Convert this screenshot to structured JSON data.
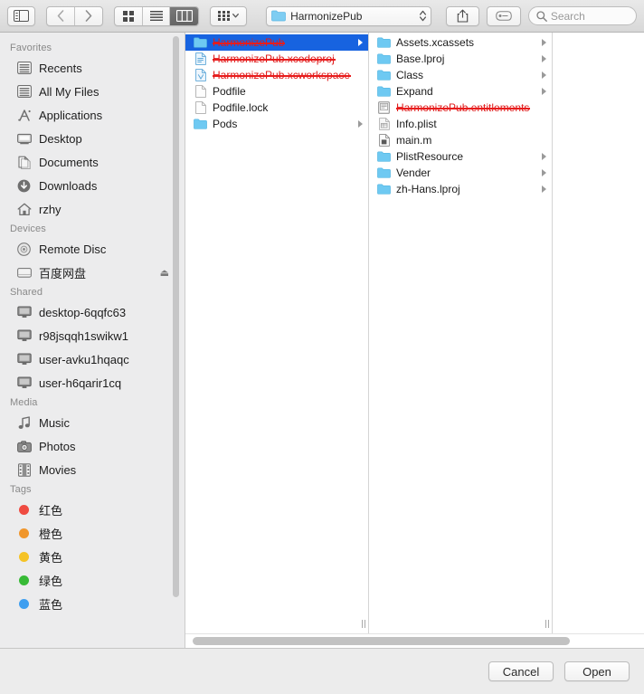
{
  "window": {
    "title": "HarmonizePub"
  },
  "toolbar": {
    "sidebar_toggle": "sidebar-toggle",
    "back_label": "Back",
    "forward_label": "Forward",
    "view_icon_label": "Icon View",
    "view_list_label": "List View",
    "view_column_label": "Column View",
    "arrange_label": "Arrange By",
    "path_label": "HarmonizePub",
    "share_label": "Share",
    "tag_label": "Tags",
    "search_placeholder": "Search"
  },
  "sidebar": {
    "sections": [
      {
        "title": "Favorites",
        "items": [
          {
            "label": "Recents",
            "icon": "recents-icon"
          },
          {
            "label": "All My Files",
            "icon": "all-my-files-icon"
          },
          {
            "label": "Applications",
            "icon": "applications-icon"
          },
          {
            "label": "Desktop",
            "icon": "desktop-icon"
          },
          {
            "label": "Documents",
            "icon": "documents-icon"
          },
          {
            "label": "Downloads",
            "icon": "downloads-icon"
          },
          {
            "label": "rzhy",
            "icon": "home-icon"
          }
        ]
      },
      {
        "title": "Devices",
        "items": [
          {
            "label": "Remote Disc",
            "icon": "remote-disc-icon"
          },
          {
            "label": "百度网盘",
            "icon": "external-drive-icon",
            "eject": "⏏"
          }
        ]
      },
      {
        "title": "Shared",
        "items": [
          {
            "label": "desktop-6qqfc63",
            "icon": "computer-icon"
          },
          {
            "label": "r98jsqqh1swikw1",
            "icon": "computer-icon"
          },
          {
            "label": "user-avku1hqaqc",
            "icon": "computer-icon"
          },
          {
            "label": "user-h6qarir1cq",
            "icon": "computer-icon"
          }
        ]
      },
      {
        "title": "Media",
        "items": [
          {
            "label": "Music",
            "icon": "music-icon"
          },
          {
            "label": "Photos",
            "icon": "photos-icon"
          },
          {
            "label": "Movies",
            "icon": "movies-icon"
          }
        ]
      },
      {
        "title": "Tags",
        "items": [
          {
            "label": "红色",
            "icon": "tag-dot",
            "color": "#ef4b41"
          },
          {
            "label": "橙色",
            "icon": "tag-dot",
            "color": "#f0962c"
          },
          {
            "label": "黄色",
            "icon": "tag-dot",
            "color": "#f5c326"
          },
          {
            "label": "绿色",
            "icon": "tag-dot",
            "color": "#37ba36"
          },
          {
            "label": "蓝色",
            "icon": "tag-dot",
            "color": "#3f9ff0"
          }
        ]
      }
    ]
  },
  "columns": [
    {
      "name": "column-1",
      "rows": [
        {
          "label": "HarmonizePub",
          "icon": "folder-icon",
          "selected": true,
          "has_arrow": true,
          "redacted": true
        },
        {
          "label": "HarmonizePub.xcodeproj",
          "icon": "xcodeproj-icon",
          "selected": false,
          "has_arrow": false,
          "redacted": true
        },
        {
          "label": "HarmonizePub.xcworkspace",
          "icon": "xcworkspace-icon",
          "selected": false,
          "has_arrow": false,
          "redacted": true
        },
        {
          "label": "Podfile",
          "icon": "file-icon",
          "selected": false,
          "has_arrow": false,
          "redacted": false
        },
        {
          "label": "Podfile.lock",
          "icon": "file-icon",
          "selected": false,
          "has_arrow": false,
          "redacted": false
        },
        {
          "label": "Pods",
          "icon": "folder-icon",
          "selected": false,
          "has_arrow": true,
          "redacted": false
        }
      ]
    },
    {
      "name": "column-2",
      "rows": [
        {
          "label": "Assets.xcassets",
          "icon": "folder-icon",
          "selected": false,
          "has_arrow": true,
          "redacted": false
        },
        {
          "label": "Base.lproj",
          "icon": "folder-icon",
          "selected": false,
          "has_arrow": true,
          "redacted": false
        },
        {
          "label": "Class",
          "icon": "folder-icon",
          "selected": false,
          "has_arrow": true,
          "redacted": false
        },
        {
          "label": "Expand",
          "icon": "folder-icon",
          "selected": false,
          "has_arrow": true,
          "redacted": false
        },
        {
          "label": "HarmonizePub.entitlements",
          "icon": "entitlements-icon",
          "selected": false,
          "has_arrow": false,
          "redacted": true
        },
        {
          "label": "Info.plist",
          "icon": "plist-icon",
          "selected": false,
          "has_arrow": false,
          "redacted": false
        },
        {
          "label": "main.m",
          "icon": "source-icon",
          "selected": false,
          "has_arrow": false,
          "redacted": false
        },
        {
          "label": "PlistResource",
          "icon": "folder-icon",
          "selected": false,
          "has_arrow": true,
          "redacted": false
        },
        {
          "label": "Vender",
          "icon": "folder-icon",
          "selected": false,
          "has_arrow": true,
          "redacted": false
        },
        {
          "label": "zh-Hans.lproj",
          "icon": "folder-icon",
          "selected": false,
          "has_arrow": true,
          "redacted": false
        }
      ]
    },
    {
      "name": "column-3",
      "rows": []
    }
  ],
  "footer": {
    "cancel_label": "Cancel",
    "open_label": "Open"
  },
  "colors": {
    "selection": "#1763e0",
    "redaction": "#e81c1c",
    "folder": "#6fcbf4",
    "sidebar_bg": "#ececed"
  }
}
